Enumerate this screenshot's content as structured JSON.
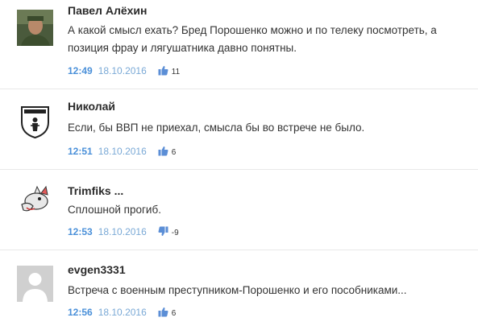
{
  "comments": [
    {
      "author": "Павел Алёхин",
      "text_line1": "А какой смысл ехать? Бред Порошенко можно и по телеку посмотреть, а",
      "text_line2": "позиция фрау и лягушатника давно понятны.",
      "time": "12:49",
      "date": "18.10.2016",
      "rating": "11",
      "vote_icon": "thumbs-up-icon"
    },
    {
      "author": "Николай",
      "text_line1": "Если, бы ВВП не приехал, смысла бы во встрече не было.",
      "time": "12:51",
      "date": "18.10.2016",
      "rating": "6",
      "vote_icon": "thumbs-up-icon"
    },
    {
      "author": "Trimfiks ...",
      "text_line1": "Сплошной прогиб.",
      "time": "12:53",
      "date": "18.10.2016",
      "rating": "-9",
      "vote_icon": "thumbs-down-icon"
    },
    {
      "author": "evgen3331",
      "text_line1": "Встреча с военным преступником-Порошенко и его пособниками...",
      "time": "12:56",
      "date": "18.10.2016",
      "rating": "6",
      "vote_icon": "thumbs-up-icon"
    }
  ],
  "colors": {
    "time": "#4a90d9",
    "date": "#7aa9d6",
    "thumb": "#5b8ed6"
  }
}
